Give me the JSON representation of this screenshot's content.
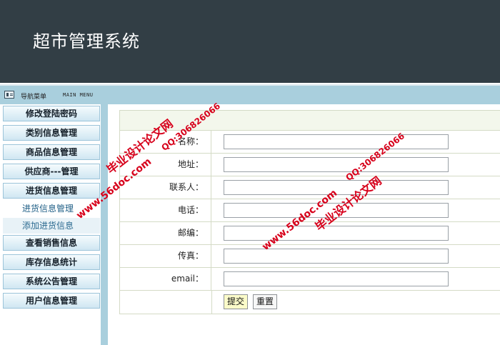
{
  "app": {
    "title": "超市管理系统"
  },
  "navbar": {
    "label_cn": "导航菜单",
    "label_en": "MAIN MENU"
  },
  "sidebar": {
    "items": [
      {
        "label": "修改登陆密码"
      },
      {
        "label": "类别信息管理"
      },
      {
        "label": "商品信息管理"
      },
      {
        "label": "供应商---管理"
      },
      {
        "label": "进货信息管理"
      }
    ],
    "subitems": [
      {
        "label": "进货信息管理"
      },
      {
        "label": "添加进货信息"
      }
    ],
    "items_after": [
      {
        "label": "查看销售信息"
      },
      {
        "label": "库存信息统计"
      },
      {
        "label": "系统公告管理"
      },
      {
        "label": "用户信息管理"
      }
    ]
  },
  "form": {
    "fields": [
      {
        "label": "名称：",
        "value": ""
      },
      {
        "label": "地址：",
        "value": ""
      },
      {
        "label": "联系人：",
        "value": ""
      },
      {
        "label": "电话：",
        "value": ""
      },
      {
        "label": "邮编：",
        "value": ""
      },
      {
        "label": "传真：",
        "value": ""
      },
      {
        "label": "email：",
        "value": ""
      }
    ],
    "submit_label": "提交",
    "reset_label": "重置"
  },
  "watermarks": {
    "site": "www.56doc.com",
    "name": "毕业设计论文网",
    "qq": "QQ:306826066"
  },
  "colors": {
    "header_bg": "#323e45",
    "nav_bg": "#a9cfdd",
    "watermark": "#d7001b"
  }
}
